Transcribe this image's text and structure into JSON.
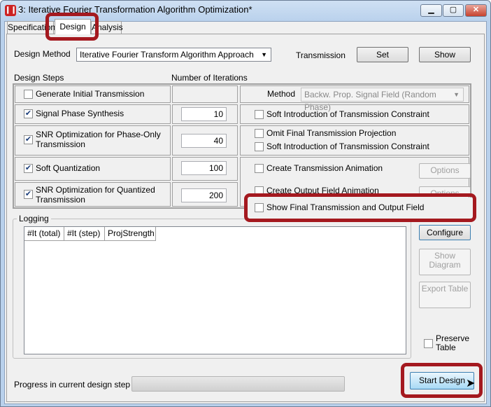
{
  "window": {
    "title": "3: Iterative Fourier Transformation Algorithm Optimization*",
    "app_icon_glyph": "❙❙❙",
    "minimize_glyph": "▁",
    "maximize_glyph": "▢",
    "close_glyph": "✕"
  },
  "tabs": [
    {
      "label": "Specification"
    },
    {
      "label": "Design",
      "selected": true
    },
    {
      "label": "Analysis"
    }
  ],
  "design": {
    "method_label": "Design Method",
    "method_value": "Iterative Fourier Transform Algorithm Approach",
    "transmission_label": "Transmission",
    "set_label": "Set",
    "show_label": "Show",
    "steps_header": "Design Steps",
    "iterations_header": "Number of Iterations",
    "steps": [
      {
        "label": "Generate Initial Transmission",
        "checked": false,
        "iterations": ""
      },
      {
        "label": "Signal Phase Synthesis",
        "checked": true,
        "iterations": "10"
      },
      {
        "label": "SNR Optimization for Phase-Only Transmission",
        "checked": true,
        "iterations": "40"
      },
      {
        "label": "Soft Quantization",
        "checked": true,
        "iterations": "100"
      },
      {
        "label": "SNR Optimization for Quantized Transmission",
        "checked": true,
        "iterations": "200"
      }
    ],
    "method_sub_label": "Method",
    "method_sub_value": "Backw. Prop. Signal Field (Random Phase)",
    "options": [
      {
        "label": "Soft Introduction of Transmission Constraint",
        "checked": false
      },
      {
        "label": "Omit Final Transmission Projection",
        "checked": false
      },
      {
        "label": "Soft Introduction of Transmission Constraint",
        "checked": false
      },
      {
        "label": "Create Transmission Animation",
        "checked": false
      },
      {
        "label": "Create Output Field Animation",
        "checked": false
      },
      {
        "label": "Show Final Transmission and Output Field",
        "checked": false
      }
    ],
    "options_button_1": "Options",
    "options_button_2": "Options"
  },
  "logging": {
    "label": "Logging",
    "columns": [
      "#It (total)",
      "#It (step)",
      "ProjStrength"
    ],
    "configure_label": "Configure",
    "show_diagram_label": "Show Diagram",
    "export_table_label": "Export Table",
    "preserve_table_label": "Preserve Table"
  },
  "footer": {
    "progress_label": "Progress in current design step",
    "progress_fraction": 0.0,
    "start_label": "Start Design"
  },
  "colors": {
    "highlight": "#a4191f",
    "title_gradient": "#b9d1ec",
    "start_button": "#a7d9f5"
  }
}
